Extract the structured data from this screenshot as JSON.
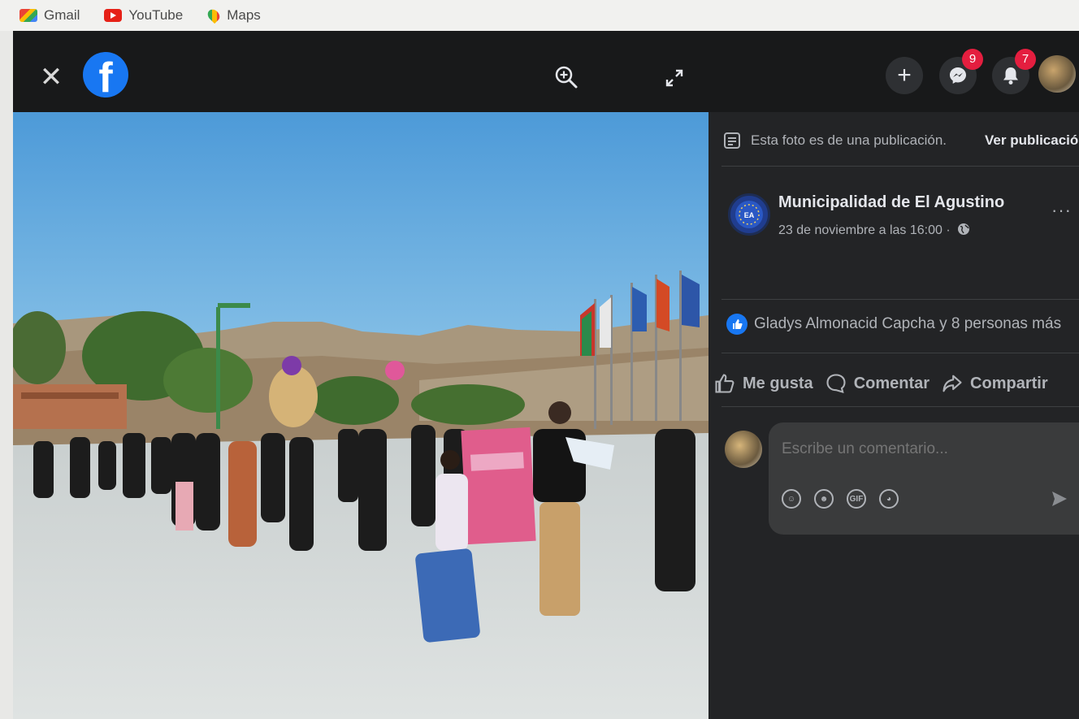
{
  "bookmarks": [
    {
      "label": "Gmail",
      "icon": "gmail-icon"
    },
    {
      "label": "YouTube",
      "icon": "youtube-icon"
    },
    {
      "label": "Maps",
      "icon": "maps-icon"
    }
  ],
  "topbar": {
    "close_symbol": "✕",
    "logo_letter": "f",
    "plus_symbol": "+",
    "messenger_badge": "9",
    "notifications_badge": "7"
  },
  "panel": {
    "notice": "Esta foto es de una publicación.",
    "view_post": "Ver publicación",
    "page_name": "Municipalidad de El Agustino",
    "date": "23 de noviembre a las 16:00 ·",
    "likes": "Gladys Almonacid Capcha y 8 personas más",
    "actions": {
      "like": "Me gusta",
      "comment": "Comentar",
      "share": "Compartir"
    },
    "comment_placeholder": "Escribe un comentario...",
    "more": "···"
  },
  "colors": {
    "facebook_blue": "#1877f2",
    "badge_red": "#e41e3f",
    "panel_bg": "#232426"
  }
}
